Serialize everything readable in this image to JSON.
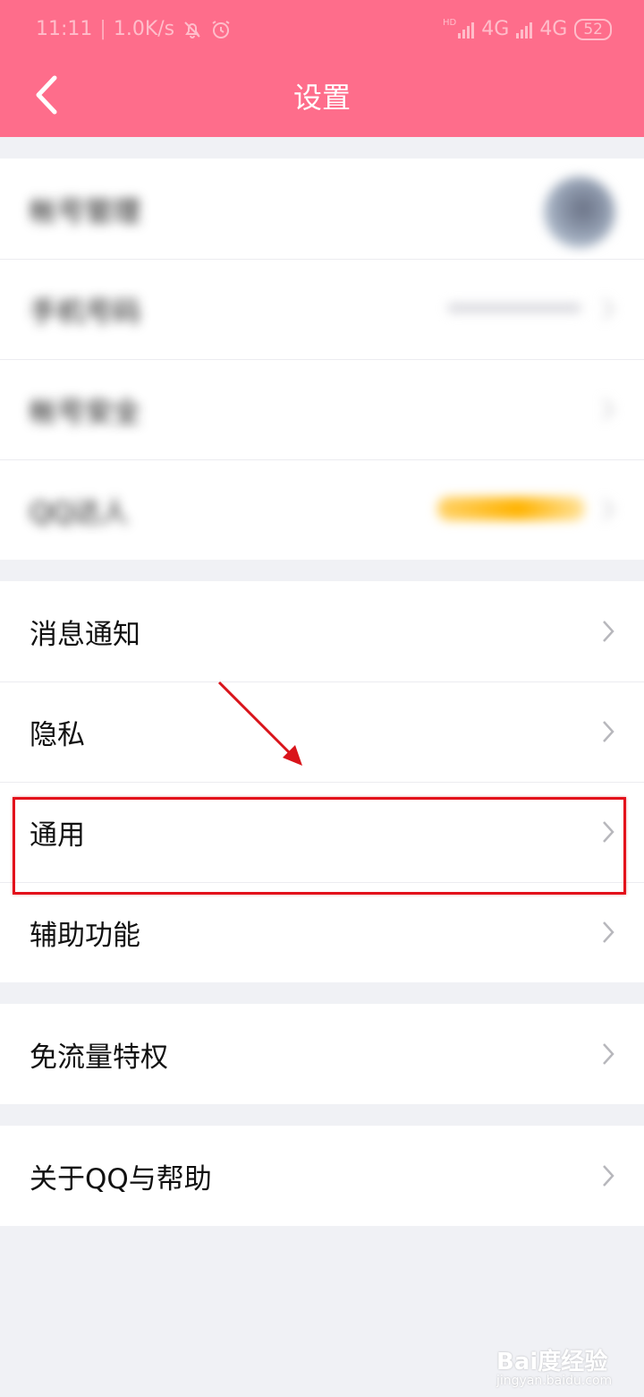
{
  "status_bar": {
    "time": "11:11",
    "speed": "1.0K/s",
    "network_1": "4G",
    "network_2": "4G",
    "hd_label": "HD",
    "battery": "52",
    "icons": [
      "bell-off-icon",
      "alarm-icon",
      "signal-icon",
      "signal-icon"
    ]
  },
  "nav": {
    "title": "设置",
    "back_icon": "chevron-left-icon"
  },
  "account_group": {
    "items": [
      {
        "label": "帐号管理",
        "blurred": true
      },
      {
        "label": "手机号码",
        "blurred": true
      },
      {
        "label": "帐号安全",
        "blurred": true
      },
      {
        "label": "QQ达人",
        "blurred": true
      }
    ]
  },
  "settings_group": {
    "items": [
      {
        "label": "消息通知"
      },
      {
        "label": "隐私"
      },
      {
        "label": "通用",
        "highlighted": true
      },
      {
        "label": "辅助功能"
      }
    ]
  },
  "data_group": {
    "items": [
      {
        "label": "免流量特权"
      }
    ]
  },
  "about_group": {
    "items": [
      {
        "label": "关于QQ与帮助"
      }
    ]
  },
  "annotation": {
    "highlight_color": "#e3111b"
  },
  "watermark": {
    "brand": "Bai度经验",
    "url": "jingyan.baidu.com"
  },
  "colors": {
    "header": "#fe6d8b",
    "background": "#f0f1f5"
  }
}
